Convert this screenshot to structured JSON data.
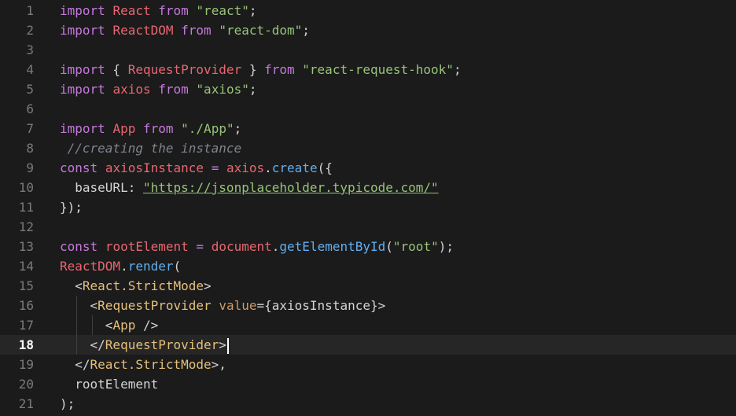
{
  "colors": {
    "keyword": "#c679dd",
    "identifier": "#e86671",
    "string": "#98c379",
    "function": "#61afef",
    "tag": "#e5c07b",
    "attr": "#d19a66",
    "comment": "#7f848e",
    "punct": "#d4d4d4",
    "text": "#d4d4d4"
  },
  "active_line": 18,
  "lines": [
    {
      "n": "1",
      "tokens": [
        [
          "keyword",
          "import"
        ],
        [
          "punct",
          " "
        ],
        [
          "identifier",
          "React"
        ],
        [
          "punct",
          " "
        ],
        [
          "keyword",
          "from"
        ],
        [
          "punct",
          " "
        ],
        [
          "string",
          "\"react\""
        ],
        [
          "punct",
          ";"
        ]
      ]
    },
    {
      "n": "2",
      "tokens": [
        [
          "keyword",
          "import"
        ],
        [
          "punct",
          " "
        ],
        [
          "identifier",
          "ReactDOM"
        ],
        [
          "punct",
          " "
        ],
        [
          "keyword",
          "from"
        ],
        [
          "punct",
          " "
        ],
        [
          "string",
          "\"react-dom\""
        ],
        [
          "punct",
          ";"
        ]
      ]
    },
    {
      "n": "3",
      "tokens": []
    },
    {
      "n": "4",
      "tokens": [
        [
          "keyword",
          "import"
        ],
        [
          "punct",
          " { "
        ],
        [
          "identifier",
          "RequestProvider"
        ],
        [
          "punct",
          " } "
        ],
        [
          "keyword",
          "from"
        ],
        [
          "punct",
          " "
        ],
        [
          "string",
          "\"react-request-hook\""
        ],
        [
          "punct",
          ";"
        ]
      ]
    },
    {
      "n": "5",
      "tokens": [
        [
          "keyword",
          "import"
        ],
        [
          "punct",
          " "
        ],
        [
          "identifier",
          "axios"
        ],
        [
          "punct",
          " "
        ],
        [
          "keyword",
          "from"
        ],
        [
          "punct",
          " "
        ],
        [
          "string",
          "\"axios\""
        ],
        [
          "punct",
          ";"
        ]
      ]
    },
    {
      "n": "6",
      "tokens": []
    },
    {
      "n": "7",
      "tokens": [
        [
          "keyword",
          "import"
        ],
        [
          "punct",
          " "
        ],
        [
          "identifier",
          "App"
        ],
        [
          "punct",
          " "
        ],
        [
          "keyword",
          "from"
        ],
        [
          "punct",
          " "
        ],
        [
          "string",
          "\"./App\""
        ],
        [
          "punct",
          ";"
        ]
      ]
    },
    {
      "n": "8",
      "tokens": [
        [
          "comment",
          " //creating the instance"
        ]
      ]
    },
    {
      "n": "9",
      "tokens": [
        [
          "keyword",
          "const"
        ],
        [
          "punct",
          " "
        ],
        [
          "identifier",
          "axiosInstance"
        ],
        [
          "punct",
          " "
        ],
        [
          "keyword",
          "="
        ],
        [
          "punct",
          " "
        ],
        [
          "identifier",
          "axios"
        ],
        [
          "punct",
          "."
        ],
        [
          "function",
          "create"
        ],
        [
          "punct",
          "({"
        ]
      ]
    },
    {
      "n": "10",
      "tokens": [
        [
          "punct",
          "  baseURL: "
        ],
        [
          "string",
          "\"https://jsonplaceholder.typicode.com/\""
        ]
      ]
    },
    {
      "n": "11",
      "tokens": [
        [
          "punct",
          "});"
        ]
      ]
    },
    {
      "n": "12",
      "tokens": []
    },
    {
      "n": "13",
      "tokens": [
        [
          "keyword",
          "const"
        ],
        [
          "punct",
          " "
        ],
        [
          "identifier",
          "rootElement"
        ],
        [
          "punct",
          " "
        ],
        [
          "keyword",
          "="
        ],
        [
          "punct",
          " "
        ],
        [
          "identifier",
          "document"
        ],
        [
          "punct",
          "."
        ],
        [
          "function",
          "getElementById"
        ],
        [
          "punct",
          "("
        ],
        [
          "string",
          "\"root\""
        ],
        [
          "punct",
          ");"
        ]
      ]
    },
    {
      "n": "14",
      "tokens": [
        [
          "identifier",
          "ReactDOM"
        ],
        [
          "punct",
          "."
        ],
        [
          "function",
          "render"
        ],
        [
          "punct",
          "("
        ]
      ]
    },
    {
      "n": "15",
      "tokens": [
        [
          "punct",
          "  <"
        ],
        [
          "tag",
          "React.StrictMode"
        ],
        [
          "punct",
          ">"
        ]
      ]
    },
    {
      "n": "16",
      "tokens": [
        [
          "punct",
          "    <"
        ],
        [
          "tag",
          "RequestProvider"
        ],
        [
          "punct",
          " "
        ],
        [
          "attr",
          "value"
        ],
        [
          "punct",
          "={axiosInstance}>"
        ]
      ]
    },
    {
      "n": "17",
      "tokens": [
        [
          "punct",
          "      <"
        ],
        [
          "tag",
          "App"
        ],
        [
          "punct",
          " />"
        ]
      ]
    },
    {
      "n": "18",
      "tokens": [
        [
          "punct",
          "    </"
        ],
        [
          "tag",
          "RequestProvider"
        ],
        [
          "punct",
          ">"
        ]
      ]
    },
    {
      "n": "19",
      "tokens": [
        [
          "punct",
          "  </"
        ],
        [
          "tag",
          "React.StrictMode"
        ],
        [
          "punct",
          ">,"
        ]
      ]
    },
    {
      "n": "20",
      "tokens": [
        [
          "punct",
          "  rootElement"
        ]
      ]
    },
    {
      "n": "21",
      "tokens": [
        [
          "punct",
          ");"
        ]
      ]
    }
  ]
}
